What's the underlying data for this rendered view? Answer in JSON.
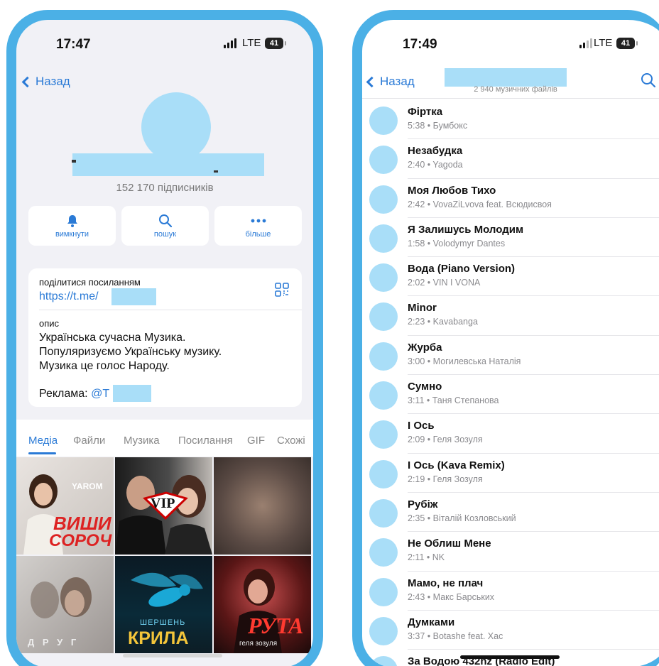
{
  "left": {
    "time": "17:47",
    "network": "LTE",
    "battery": "41",
    "back_label": "Назад",
    "subscribers": "152 170 підписників",
    "actions": [
      {
        "label": "вимкнути",
        "icon": "bell-icon"
      },
      {
        "label": "пошук",
        "icon": "search-icon"
      },
      {
        "label": "більше",
        "icon": "more-icon"
      }
    ],
    "share_label": "поділитися посиланням",
    "link_text": "https://t.me/",
    "description_label": "опис",
    "description_lines": [
      "Українська сучасна Музика.",
      "Популяризуємо Українську музику.",
      "Музика це голос Народу."
    ],
    "ad_label": "Реклама:",
    "ad_handle": "@T",
    "tabs": [
      "Медіа",
      "Файли",
      "Музика",
      "Посилання",
      "GIF",
      "Схожі"
    ],
    "active_tab": "Медіа",
    "covers": [
      {
        "text": "YAROM",
        "text2": "ВИШИ",
        "text3": "СОРОЧ"
      },
      {
        "text": "VIP"
      },
      {
        "text": ""
      },
      {
        "text": "Д Р У Г"
      },
      {
        "text": "ШЕРШЕНЬ",
        "text2": "КРИЛА"
      },
      {
        "text": "РУТА",
        "text2": "геля зозуля"
      }
    ]
  },
  "right": {
    "time": "17:49",
    "network": "LTE",
    "battery": "41",
    "back_label": "Назад",
    "files_count": "2 940 музичних файлів",
    "tracks": [
      {
        "title": "Фіртка",
        "meta": "5:38 • Бумбокс"
      },
      {
        "title": "Незабудка",
        "meta": "2:40 • Yagoda"
      },
      {
        "title": "Моя Любов Тихо",
        "meta": "2:42 • VovaZiLvova feat. Всюдисвоя"
      },
      {
        "title": "Я Залишусь Молодим",
        "meta": "1:58 • Volodymyr Dantes"
      },
      {
        "title": "Вода (Piano Version)",
        "meta": "2:02 • VIN I VONA"
      },
      {
        "title": "Minor",
        "meta": "2:23 • Kavabanga"
      },
      {
        "title": "Журба",
        "meta": "3:00 • Могилевська Наталія"
      },
      {
        "title": "Сумно",
        "meta": "3:11 • Таня Степанова"
      },
      {
        "title": "І Ось",
        "meta": "2:09 • Геля Зозуля"
      },
      {
        "title": "І Ось (Kava Remix)",
        "meta": "2:19 • Геля Зозуля"
      },
      {
        "title": "Рубіж",
        "meta": "2:35 • Віталій Козловський"
      },
      {
        "title": "Не Облиш Мене",
        "meta": "2:11 • NK"
      },
      {
        "title": "Мамо, не плач",
        "meta": "2:43 • Макс Барських"
      },
      {
        "title": "Думками",
        "meta": "3:37 • Botashe feat. Xac"
      },
      {
        "title": "За Водою 432hz (Radio Edit)",
        "meta": ""
      }
    ]
  },
  "colors": {
    "accent": "#2a7ad6",
    "frame": "#4bb0e6",
    "redaction": "#a9def8"
  }
}
